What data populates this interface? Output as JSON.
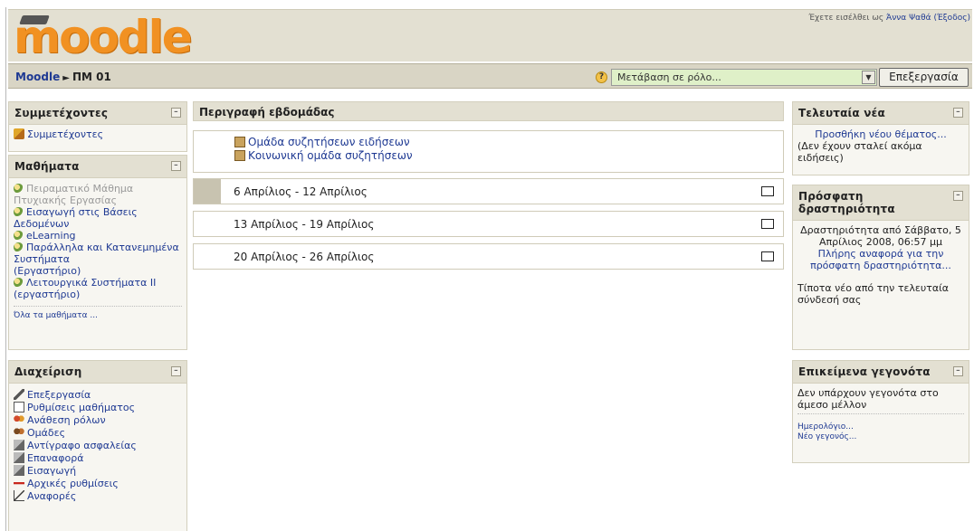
{
  "header": {
    "logo_text": "moodle",
    "login_prefix": "Έχετε εισέλθει ως",
    "user_name": "Άννα Ψαθά",
    "logout": "(Έξοδος)"
  },
  "navbar": {
    "home": "Moodle",
    "separator": "►",
    "course": "ΠΜ 01",
    "role_select": "Μετάβαση σε ρόλο...",
    "edit_button": "Επεξεργασία",
    "help_glyph": "?"
  },
  "participants": {
    "title": "Συμμετέχοντες",
    "item": "Συμμετέχοντες"
  },
  "courses": {
    "title": "Μαθήματα",
    "items": [
      "Πειραματικό Μάθημα Πτυχιακής Εργασίας",
      "Εισαγωγή στις Βάσεις Δεδομένων",
      "eLearning",
      "Παράλληλα και Κατανεμημένα Συστήματα",
      "(Εργαστήριο)",
      "Λειτουργικά Συστήματα ΙΙ (εργαστήριο)"
    ],
    "all_courses": "Όλα τα μαθήματα ..."
  },
  "admin": {
    "title": "Διαχείριση",
    "items": [
      "Επεξεργασία",
      "Ρυθμίσεις μαθήματος",
      "Ανάθεση ρόλων",
      "Ομάδες",
      "Αντίγραφο ασφαλείας",
      "Επαναφορά",
      "Εισαγωγή",
      "Αρχικές ρυθμίσεις",
      "Αναφορές"
    ]
  },
  "main": {
    "title": "Περιγραφή εβδομάδας",
    "forums": [
      "Ομάδα συζητήσεων ειδήσεων",
      "Κοινωνική ομάδα συζητήσεων"
    ],
    "weeks": [
      "6 Απρίλιος - 12 Απρίλιος",
      "13 Απρίλιος - 19 Απρίλιος",
      "20 Απρίλιος - 26 Απρίλιος"
    ]
  },
  "news": {
    "title": "Τελευταία νέα",
    "add_topic": "Προσθήκη νέου θέματος...",
    "no_news": "(Δεν έχουν σταλεί ακόμα ειδήσεις)"
  },
  "activity": {
    "title": "Πρόσφατη δραστηριότητα",
    "since": "Δραστηριότητα από Σάββατο, 5 Απρίλιος 2008, 06:57 μμ",
    "full_report": "Πλήρης αναφορά για την πρόσφατη δραστηριότητα...",
    "nothing_new": "Τίποτα νέο από την τελευταία σύνδεσή σας"
  },
  "events": {
    "title": "Επικείμενα γεγονότα",
    "none": "Δεν υπάρχουν γεγονότα στο άμεσο μέλλον",
    "calendar": "Ημερολόγιο...",
    "new_event": "Νέο γεγονός..."
  },
  "collapse_glyph": "–"
}
